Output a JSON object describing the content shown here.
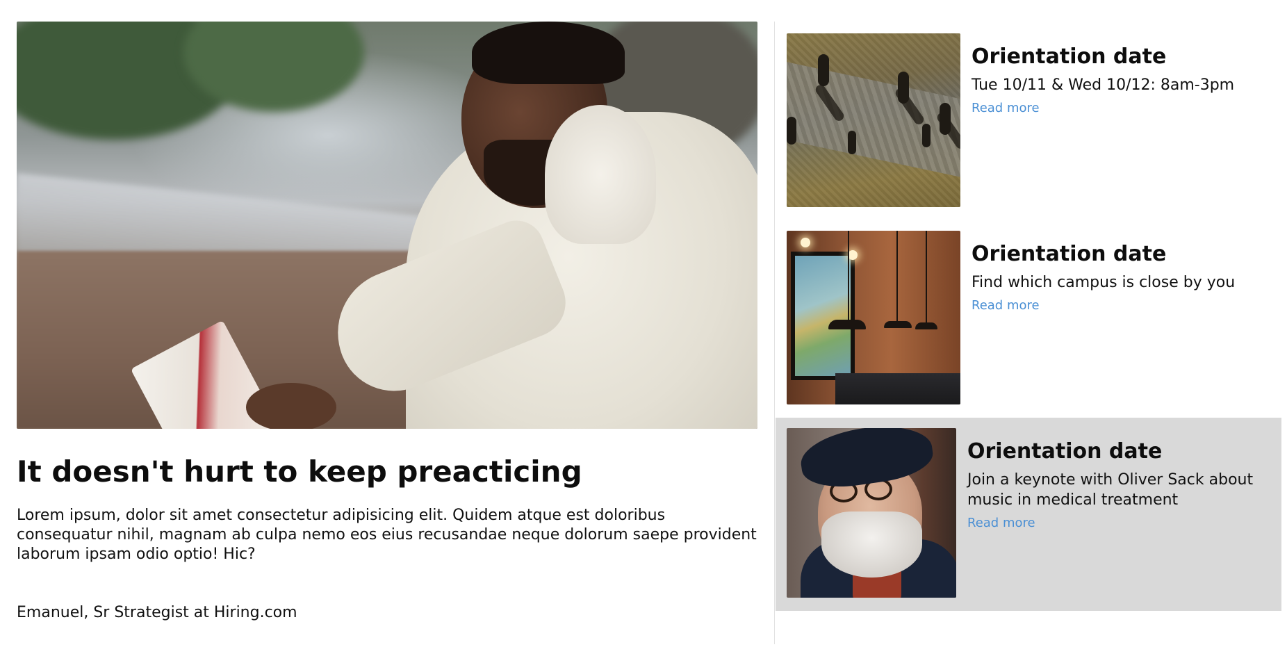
{
  "featured": {
    "title": "It doesn't hurt to keep preacticing",
    "description": "Lorem ipsum, dolor sit amet consectetur adipisicing elit. Quidem atque est doloribus consequatur nihil, magnam ab culpa nemo eos eius recusandae neque dolorum saepe provident laborum ipsam odio optio! Hic?",
    "author": "Emanuel, Sr Strategist at Hiring.com"
  },
  "cards": [
    {
      "title": "Orientation date",
      "text": "Tue 10/11 & Wed 10/12: 8am-3pm",
      "link": "Read more"
    },
    {
      "title": "Orientation date",
      "text": "Find which campus is close by you",
      "link": "Read more"
    },
    {
      "title": "Orientation date",
      "text": "Join a keynote with Oliver Sack about music in medical treatment",
      "link": "Read more"
    }
  ],
  "colors": {
    "link": "#4a8fd4",
    "active_card_bg": "#d9d9d9",
    "divider": "#e2e2e2"
  }
}
